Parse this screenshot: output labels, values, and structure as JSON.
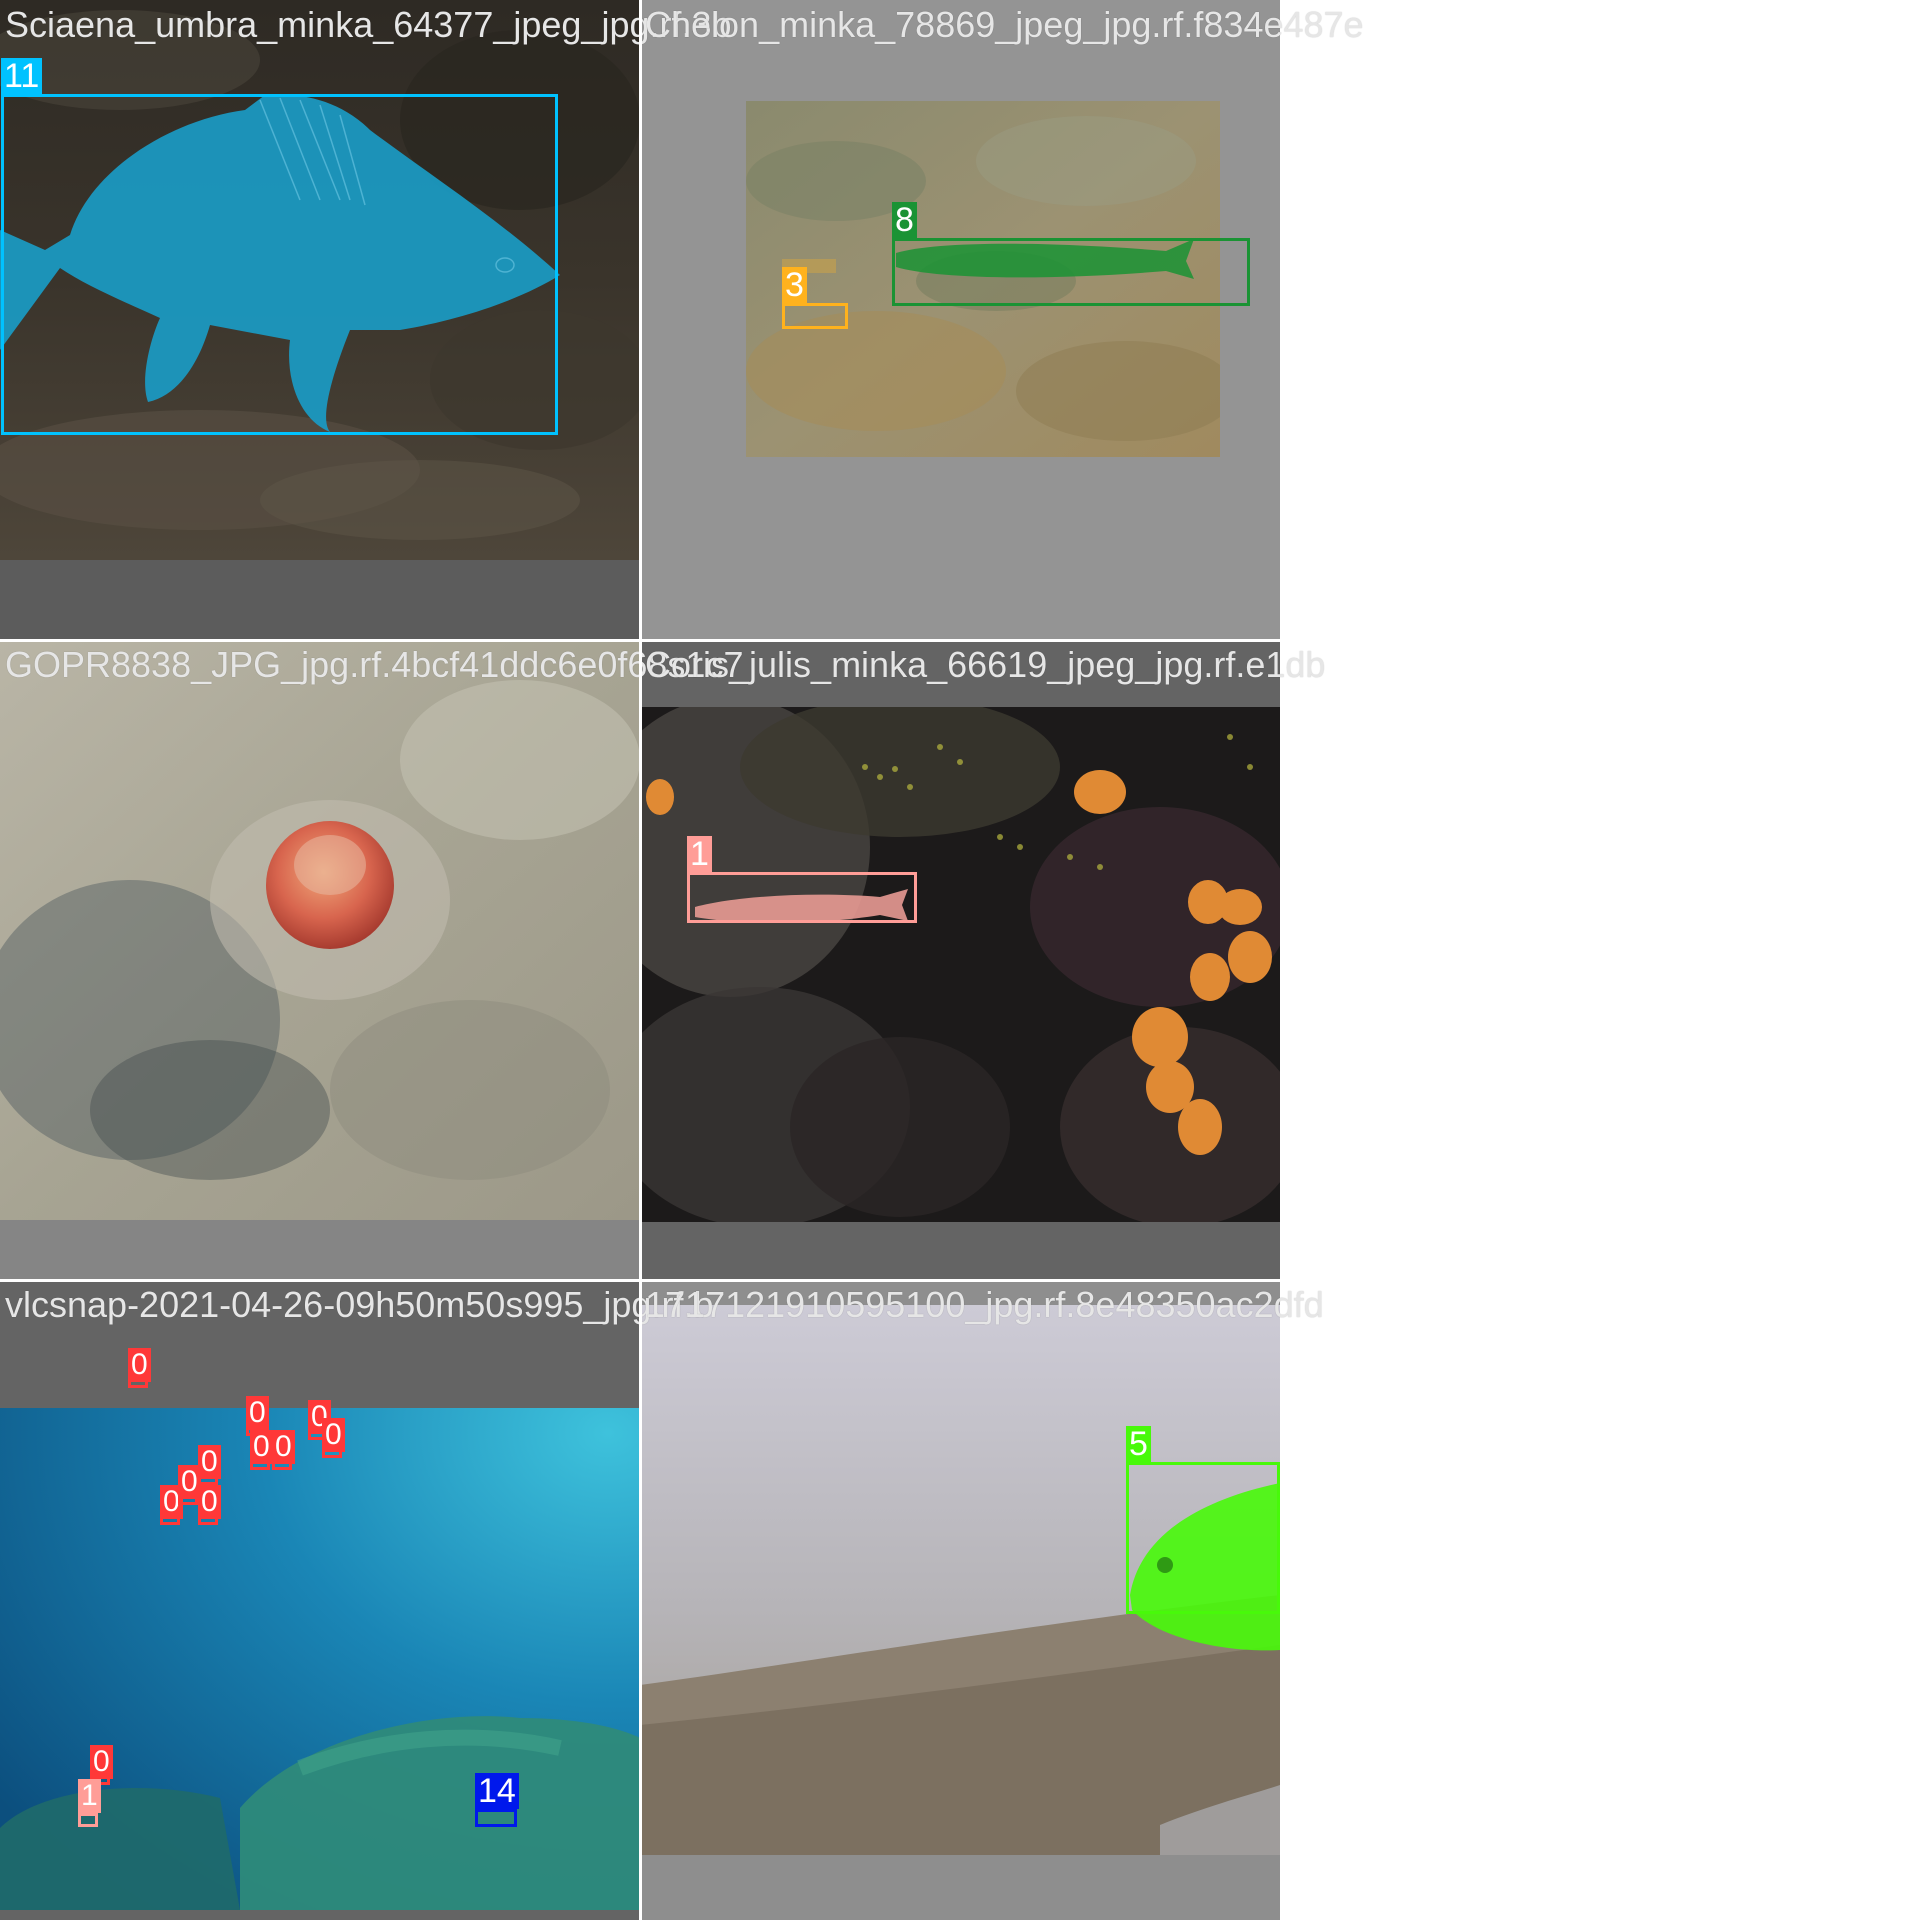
{
  "colors": {
    "class_0": "#ff3838",
    "class_1": "#ff9d97",
    "class_3": "#ffb21d",
    "class_5": "#48f90a",
    "class_8": "#1a9334",
    "class_11": "#00c2ff",
    "class_14": "#0018ec"
  },
  "tiles": [
    {
      "filename": "Sciaena_umbra_minka_64377_jpeg_jpg.rf.3b",
      "detections": [
        {
          "label": "11",
          "color_key": "class_11"
        }
      ]
    },
    {
      "filename": "Chelon_minka_78869_jpeg_jpg.rf.f834e487e",
      "detections": [
        {
          "label": "8",
          "color_key": "class_8"
        },
        {
          "label": "3",
          "color_key": "class_3"
        }
      ]
    },
    {
      "filename": "GOPR8838_JPG_jpg.rf.4bcf41ddc6e0f68s1c7",
      "detections": []
    },
    {
      "filename": "Coris_julis_minka_66619_jpeg_jpg.rf.e1db",
      "detections": [
        {
          "label": "1",
          "color_key": "class_1"
        }
      ]
    },
    {
      "filename": "vlcsnap-2021-04-26-09h50m50s995_jpg.rf.b",
      "detections": [
        {
          "label": "0",
          "color_key": "class_0"
        },
        {
          "label": "0",
          "color_key": "class_0"
        },
        {
          "label": "0",
          "color_key": "class_0"
        },
        {
          "label": "0",
          "color_key": "class_0"
        },
        {
          "label": "0",
          "color_key": "class_0"
        },
        {
          "label": "0",
          "color_key": "class_0"
        },
        {
          "label": "0",
          "color_key": "class_0"
        },
        {
          "label": "0",
          "color_key": "class_0"
        },
        {
          "label": "0",
          "color_key": "class_0"
        },
        {
          "label": "0",
          "color_key": "class_0"
        },
        {
          "label": "0",
          "color_key": "class_0"
        },
        {
          "label": "1",
          "color_key": "class_1"
        },
        {
          "label": "14",
          "color_key": "class_14"
        }
      ]
    },
    {
      "filename": "1717121910595100_jpg.rf.8e48350ac2dfd",
      "detections": [
        {
          "label": "5",
          "color_key": "class_5"
        }
      ]
    }
  ]
}
